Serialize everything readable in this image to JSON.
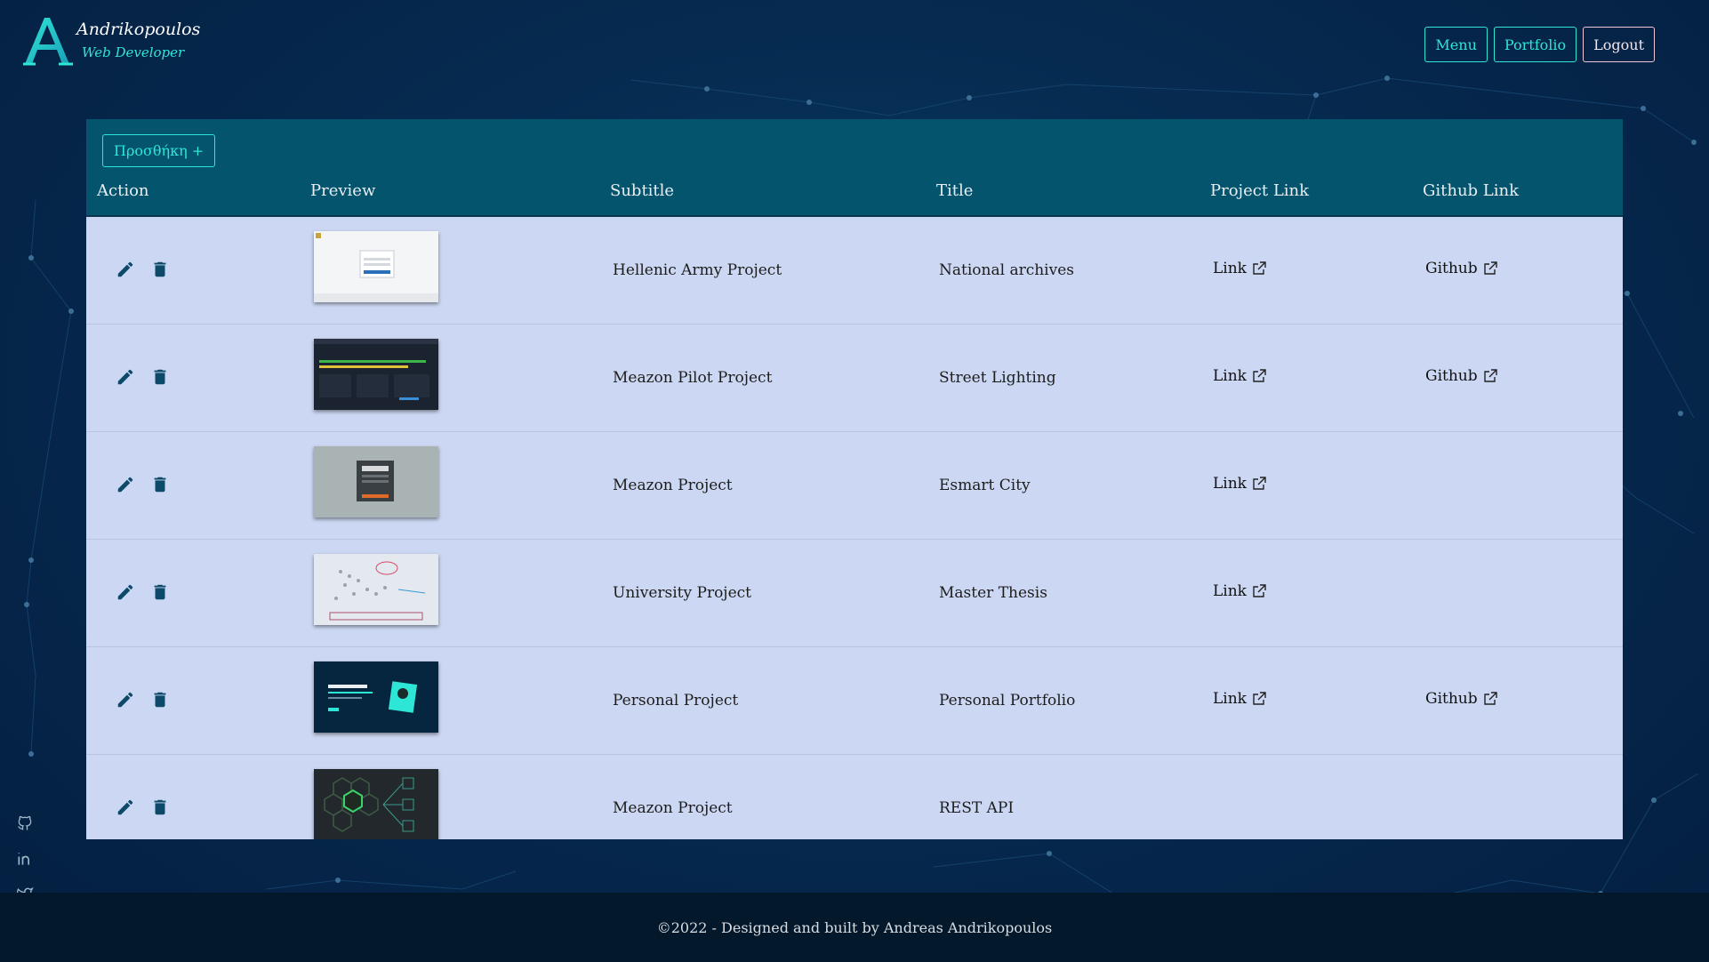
{
  "brand": {
    "name": "Andrikopoulos",
    "role": "Web Developer",
    "accent": "#2ee6d6"
  },
  "nav": {
    "menu": "Menu",
    "portfolio": "Portfolio",
    "logout": "Logout"
  },
  "table": {
    "add_button": "Προσθήκη +",
    "headers": {
      "action": "Action",
      "preview": "Preview",
      "subtitle": "Subtitle",
      "title": "Title",
      "project_link": "Project Link",
      "github_link": "Github Link"
    },
    "rows": [
      {
        "subtitle": "Hellenic Army Project",
        "title": "National archives",
        "project_link": "Link",
        "github_link": "Github",
        "thumb": "light-login"
      },
      {
        "subtitle": "Meazon Pilot Project",
        "title": "Street Lighting",
        "project_link": "Link",
        "github_link": "Github",
        "thumb": "dark-dashboard"
      },
      {
        "subtitle": "Meazon Project",
        "title": "Esmart City",
        "project_link": "Link",
        "github_link": "",
        "thumb": "grey-login"
      },
      {
        "subtitle": "University Project",
        "title": "Master Thesis",
        "project_link": "Link",
        "github_link": "",
        "thumb": "graph"
      },
      {
        "subtitle": "Personal Project",
        "title": "Personal Portfolio",
        "project_link": "Link",
        "github_link": "Github",
        "thumb": "portfolio"
      },
      {
        "subtitle": "Meazon Project",
        "title": "REST API",
        "project_link": "",
        "github_link": "",
        "thumb": "node-hex"
      }
    ]
  },
  "social": [
    "github-icon",
    "linkedin-icon",
    "twitter-icon",
    "instagram-icon"
  ],
  "footer": {
    "copyright": "©2022 - Designed and built by Andreas Andrikopoulos"
  }
}
